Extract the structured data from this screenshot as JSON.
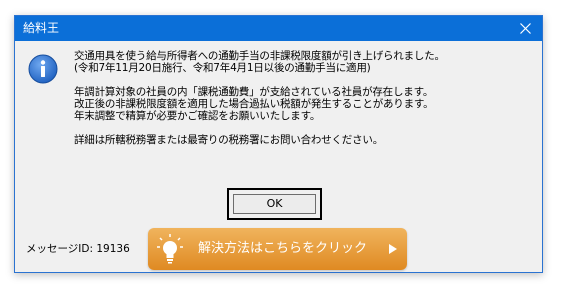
{
  "window": {
    "title": "給料王",
    "close_glyph": "✕"
  },
  "message": {
    "lines_1": [
      "交通用具を使う給与所得者への通勤手当の非課税限度額が引き上げられました。",
      "(令和7年11月20日施行、令和7年4月1日以後の通勤手当に適用)"
    ],
    "lines_2": [
      "年調計算対象の社員の内「課税通勤費」が支給されている社員が存在します。",
      "改正後の非課税限度額を適用した場合過払い税額が発生することがあります。",
      "年末調整で精算が必要かご確認をお願いいたします。"
    ],
    "lines_3": [
      "詳細は所轄税務署または最寄りの税務署にお問い合わせください。"
    ]
  },
  "buttons": {
    "ok_label": "OK",
    "help_label": "解決方法はこちらをクリック"
  },
  "footer": {
    "message_id": "メッセージID: 19136"
  },
  "icons": {
    "info": "info-icon",
    "close": "close-icon",
    "bulb": "lightbulb-icon",
    "arrow": "arrow-right-icon"
  },
  "colors": {
    "titlebar": "#0b6fd8",
    "help_button": "#e49a36",
    "info_icon": "#1d5fbf"
  }
}
